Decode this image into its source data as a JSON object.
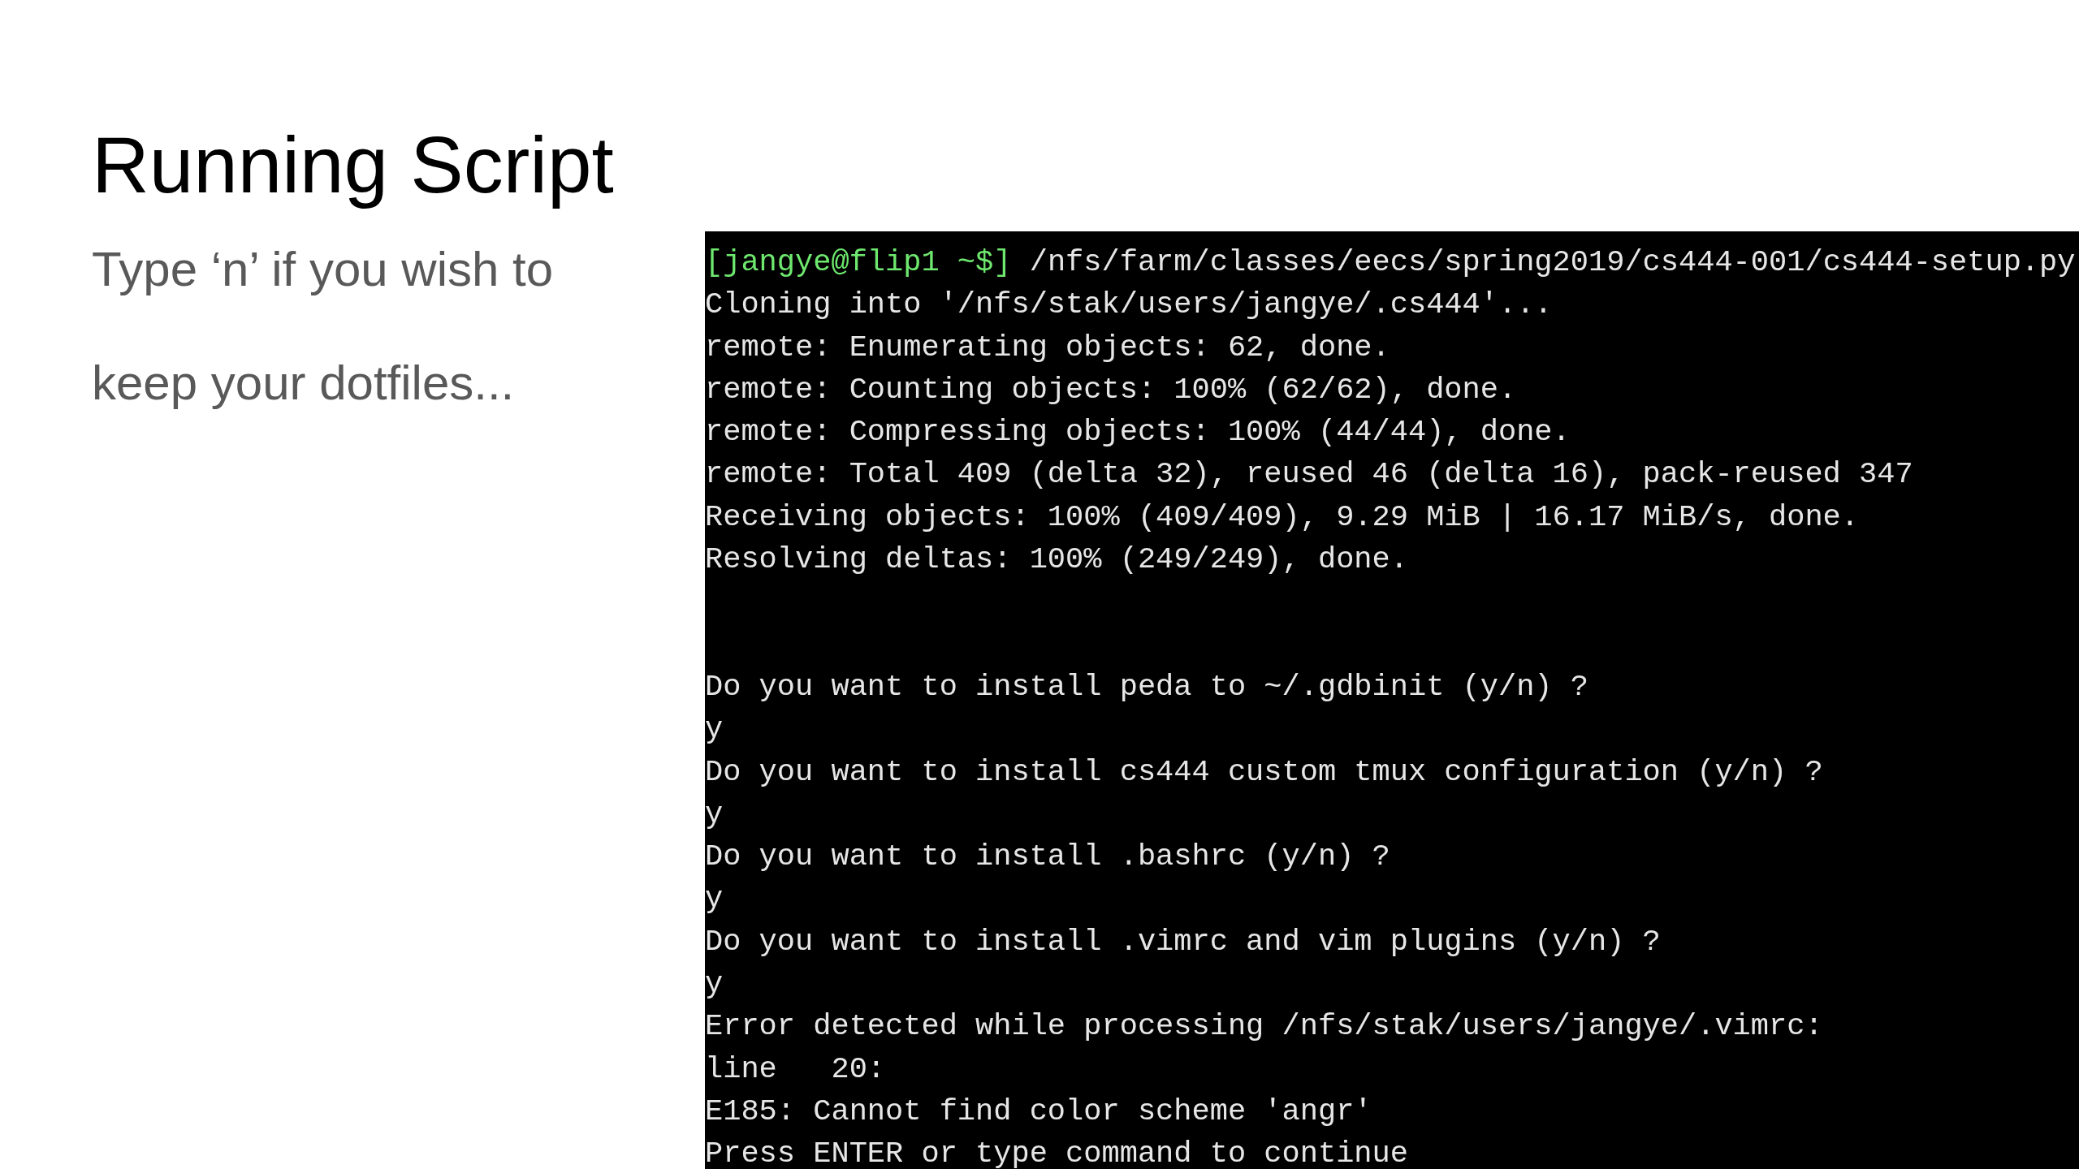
{
  "slide": {
    "title": "Running Script",
    "body_lines": [
      "Type ‘n’ if you wish to",
      "keep your dotfiles..."
    ]
  },
  "terminal": {
    "lines": [
      {
        "kind": "prompt",
        "prompt": "[jangye@flip1 ~$]",
        "text": " /nfs/farm/classes/eecs/spring2019/cs444-001/cs444-setup.py"
      },
      {
        "kind": "output",
        "text": "Cloning into '/nfs/stak/users/jangye/.cs444'..."
      },
      {
        "kind": "output",
        "text": "remote: Enumerating objects: 62, done."
      },
      {
        "kind": "output",
        "text": "remote: Counting objects: 100% (62/62), done."
      },
      {
        "kind": "output",
        "text": "remote: Compressing objects: 100% (44/44), done."
      },
      {
        "kind": "output",
        "text": "remote: Total 409 (delta 32), reused 46 (delta 16), pack-reused 347"
      },
      {
        "kind": "output",
        "text": "Receiving objects: 100% (409/409), 9.29 MiB | 16.17 MiB/s, done."
      },
      {
        "kind": "output",
        "text": "Resolving deltas: 100% (249/249), done."
      },
      {
        "kind": "blank"
      },
      {
        "kind": "blank"
      },
      {
        "kind": "output",
        "text": "Do you want to install peda to ~/.gdbinit (y/n) ?"
      },
      {
        "kind": "output",
        "text": "y"
      },
      {
        "kind": "output",
        "text": "Do you want to install cs444 custom tmux configuration (y/n) ?"
      },
      {
        "kind": "output",
        "text": "y"
      },
      {
        "kind": "output",
        "text": "Do you want to install .bashrc (y/n) ?"
      },
      {
        "kind": "output",
        "text": "y"
      },
      {
        "kind": "output",
        "text": "Do you want to install .vimrc and vim plugins (y/n) ?"
      },
      {
        "kind": "output",
        "text": "y"
      },
      {
        "kind": "output",
        "text": "Error detected while processing /nfs/stak/users/jangye/.vimrc:"
      },
      {
        "kind": "output",
        "text": "line   20:"
      },
      {
        "kind": "output",
        "text": "E185: Cannot find color scheme 'angr'"
      },
      {
        "kind": "output",
        "text": "Press ENTER or type command to continue"
      }
    ]
  }
}
